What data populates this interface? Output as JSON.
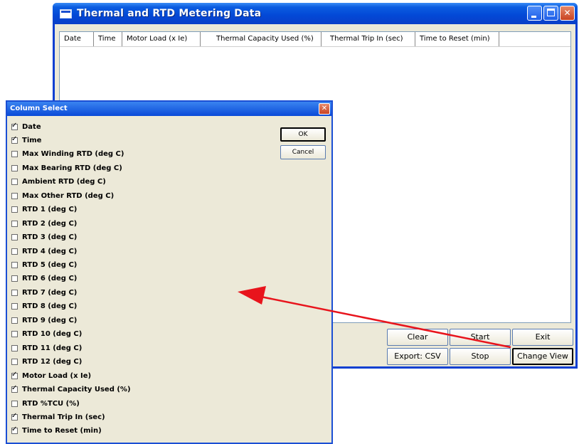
{
  "main_window": {
    "title": "Thermal and RTD Metering Data",
    "columns": [
      "Date",
      "Time",
      "Motor Load (x Ie)",
      "Thermal Capacity Used (%)",
      "Thermal Trip In (sec)",
      "Time to Reset (min)"
    ],
    "buttons": {
      "clear": "Clear",
      "start": "Start",
      "exit": "Exit",
      "export": "Export: CSV",
      "stop": "Stop",
      "change_view": "Change View"
    }
  },
  "dialog": {
    "title": "Column Select",
    "ok": "OK",
    "cancel": "Cancel",
    "options": [
      {
        "label": "Date",
        "checked": true
      },
      {
        "label": "Time",
        "checked": true
      },
      {
        "label": "Max Winding RTD (deg C)",
        "checked": false
      },
      {
        "label": "Max Bearing RTD (deg C)",
        "checked": false
      },
      {
        "label": "Ambient RTD (deg C)",
        "checked": false
      },
      {
        "label": "Max Other RTD (deg C)",
        "checked": false
      },
      {
        "label": "RTD 1 (deg C)",
        "checked": false
      },
      {
        "label": "RTD 2 (deg C)",
        "checked": false
      },
      {
        "label": "RTD 3 (deg C)",
        "checked": false
      },
      {
        "label": "RTD 4 (deg C)",
        "checked": false
      },
      {
        "label": "RTD 5 (deg C)",
        "checked": false
      },
      {
        "label": "RTD 6 (deg C)",
        "checked": false
      },
      {
        "label": "RTD 7 (deg C)",
        "checked": false
      },
      {
        "label": "RTD 8 (deg C)",
        "checked": false
      },
      {
        "label": "RTD 9 (deg C)",
        "checked": false
      },
      {
        "label": "RTD 10 (deg C)",
        "checked": false
      },
      {
        "label": "RTD 11 (deg C)",
        "checked": false
      },
      {
        "label": "RTD 12 (deg C)",
        "checked": false
      },
      {
        "label": "Motor Load (x Ie)",
        "checked": true
      },
      {
        "label": "Thermal Capacity Used (%)",
        "checked": true
      },
      {
        "label": "RTD %TCU (%)",
        "checked": false
      },
      {
        "label": "Thermal Trip In (sec)",
        "checked": true
      },
      {
        "label": "Time to Reset (min)",
        "checked": true
      }
    ]
  },
  "icons": {
    "app": "window-icon",
    "minimize": "minimize-icon",
    "maximize": "maximize-icon",
    "close": "close-icon",
    "annotation": "red-arrow-icon"
  },
  "colors": {
    "titlebar": "#0348d6",
    "dialog_face": "#ece9d8",
    "arrow": "#e8141c",
    "close_button": "#c84322"
  }
}
